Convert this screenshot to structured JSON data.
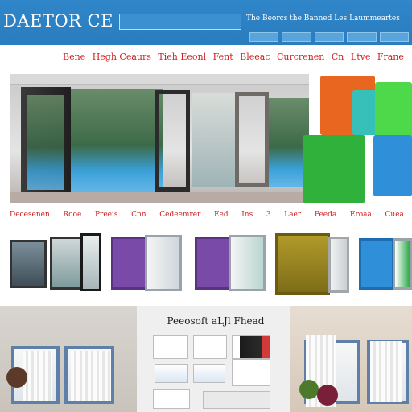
{
  "header": {
    "logo": "DAETOR  CE",
    "tagline": "The Beorcs the Banned Les Laummeartes"
  },
  "menu": {
    "items": [
      "Bene",
      "Hegh Ceaurs",
      "Tieh Eeonl",
      "Fent",
      "Bleeac",
      "Curcrenen",
      "Cn",
      "Ltve",
      "Frane"
    ]
  },
  "menu2": {
    "items": [
      "Decesenen",
      "Rooe",
      "Preeis",
      "Cnn",
      "Cedeemrer",
      "Eed",
      "Ins",
      "3",
      "Laer",
      "Peeda",
      "Eroaa",
      "Cuea"
    ]
  },
  "panel": {
    "title": "Peeosoft aLJl Fhead"
  },
  "colors": {
    "header_blue": "#2f86c9",
    "menu_red": "#d0201f",
    "tile_orange": "#e8661f",
    "tile_green": "#2fb13b",
    "tile_blue": "#2f8fd9",
    "frame_purple": "#7a4aa8",
    "frame_olive": "#a08a1e"
  }
}
